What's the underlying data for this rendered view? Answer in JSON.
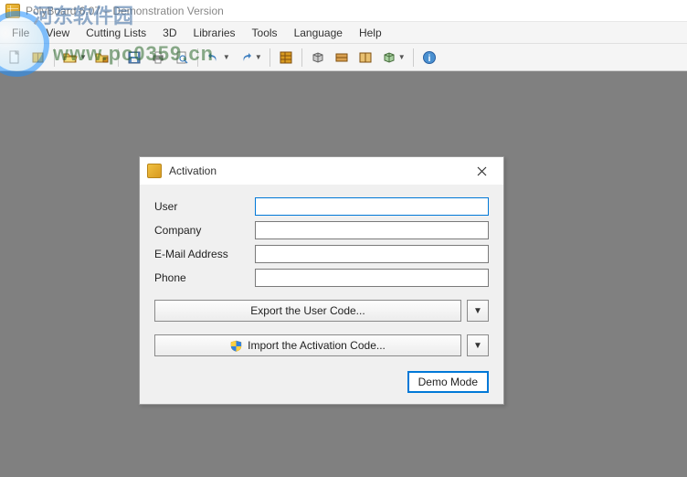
{
  "window": {
    "title": "PolyBoard 6.07 – Demonstration Version"
  },
  "watermark": {
    "line1": "河东软件园",
    "line2": "www.pc0359.cn"
  },
  "menu": {
    "items": [
      "File",
      "View",
      "Cutting Lists",
      "3D",
      "Libraries",
      "Tools",
      "Language",
      "Help"
    ]
  },
  "dialog": {
    "title": "Activation",
    "fields": {
      "user": {
        "label": "User",
        "value": ""
      },
      "company": {
        "label": "Company",
        "value": ""
      },
      "email": {
        "label": "E-Mail Address",
        "value": ""
      },
      "phone": {
        "label": "Phone",
        "value": ""
      }
    },
    "export_label": "Export the User Code...",
    "import_label": "Import the Activation Code...",
    "demo_label": "Demo Mode"
  }
}
